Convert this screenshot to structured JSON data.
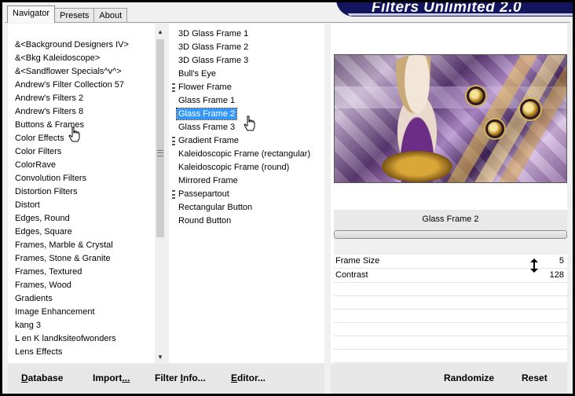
{
  "header": {
    "banner_title": "Filters Unlimited 2.0"
  },
  "tabs": [
    {
      "label": "Navigator",
      "active": true
    },
    {
      "label": "Presets",
      "active": false
    },
    {
      "label": "About",
      "active": false
    }
  ],
  "categories": [
    {
      "label": "&<Background Designers IV>"
    },
    {
      "label": "&<Bkg Kaleidoscope>"
    },
    {
      "label": "&<Sandflower Specials^v^>"
    },
    {
      "label": "Andrew's Filter Collection 57"
    },
    {
      "label": "Andrew's Filters 2"
    },
    {
      "label": "Andrew's Filters 8"
    },
    {
      "label": "Buttons & Frames"
    },
    {
      "label": "Color Effects"
    },
    {
      "label": "Color Filters"
    },
    {
      "label": "ColorRave"
    },
    {
      "label": "Convolution Filters"
    },
    {
      "label": "Distortion Filters"
    },
    {
      "label": "Distort"
    },
    {
      "label": "Edges, Round"
    },
    {
      "label": "Edges, Square"
    },
    {
      "label": "Frames, Marble & Crystal"
    },
    {
      "label": "Frames, Stone & Granite"
    },
    {
      "label": "Frames, Textured"
    },
    {
      "label": "Frames, Wood"
    },
    {
      "label": "Gradients"
    },
    {
      "label": "Image Enhancement"
    },
    {
      "label": "kang 3"
    },
    {
      "label": "L en K landksiteofwonders"
    },
    {
      "label": "Lens Effects"
    }
  ],
  "filters": [
    {
      "label": "3D Glass Frame 1",
      "grip": false,
      "selected": false
    },
    {
      "label": "3D Glass Frame 2",
      "grip": false,
      "selected": false
    },
    {
      "label": "3D Glass Frame 3",
      "grip": false,
      "selected": false
    },
    {
      "label": "Bull's Eye",
      "grip": false,
      "selected": false
    },
    {
      "label": "Flower Frame",
      "grip": true,
      "selected": false
    },
    {
      "label": "Glass Frame 1",
      "grip": false,
      "selected": false
    },
    {
      "label": "Glass Frame 2",
      "grip": false,
      "selected": true
    },
    {
      "label": "Glass Frame 3",
      "grip": false,
      "selected": false
    },
    {
      "label": "Gradient Frame",
      "grip": true,
      "selected": false
    },
    {
      "label": "Kaleidoscopic Frame (rectangular)",
      "grip": false,
      "selected": false
    },
    {
      "label": "Kaleidoscopic Frame (round)",
      "grip": false,
      "selected": false
    },
    {
      "label": "Mirrored Frame",
      "grip": false,
      "selected": false
    },
    {
      "label": "Passepartout",
      "grip": true,
      "selected": false
    },
    {
      "label": "Rectangular Button",
      "grip": false,
      "selected": false
    },
    {
      "label": "Round Button",
      "grip": false,
      "selected": false
    }
  ],
  "preview": {
    "selected_filter_name": "Glass Frame 2"
  },
  "parameters": [
    {
      "label": "Frame Size",
      "value": "5"
    },
    {
      "label": "Contrast",
      "value": "128"
    }
  ],
  "buttons": {
    "database": {
      "underlined": "D",
      "rest": "atabase"
    },
    "import": {
      "prefix": "Import",
      "underlined": "...",
      "rest": ""
    },
    "filter_info": {
      "prefix": "Filter ",
      "underlined": "I",
      "rest": "nfo..."
    },
    "editor": {
      "prefix": "",
      "underlined": "E",
      "rest": "ditor..."
    },
    "randomize": "Randomize",
    "reset": "Reset"
  }
}
